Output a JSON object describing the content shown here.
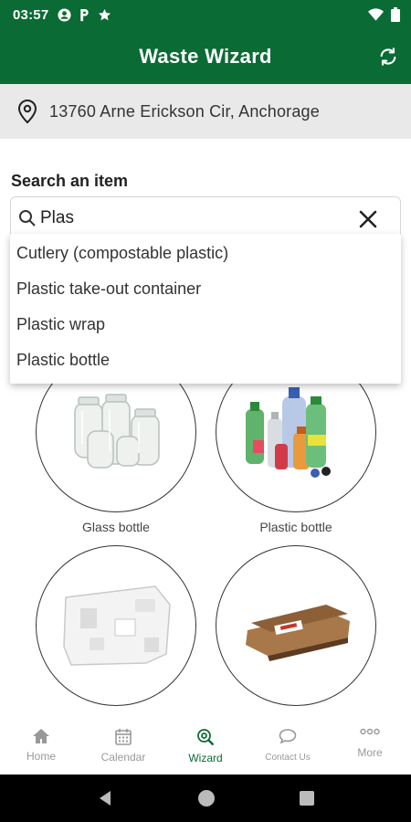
{
  "status_bar": {
    "time": "03:57",
    "icons": [
      "account-circle-icon",
      "p-icon",
      "star-icon"
    ],
    "right_icons": [
      "wifi-icon",
      "battery-icon"
    ]
  },
  "app_bar": {
    "title": "Waste Wizard",
    "refresh_icon": "refresh-icon"
  },
  "address": {
    "text": "13760 Arne Erickson Cir, Anchorage",
    "icon": "location-pin-icon"
  },
  "search": {
    "label": "Search an item",
    "value": "Plas",
    "suggestions": [
      "Cutlery (compostable plastic)",
      "Plastic take-out container",
      "Plastic wrap",
      "Plastic bottle"
    ]
  },
  "items": [
    {
      "caption": "Glass bottle",
      "image": "glass-jars"
    },
    {
      "caption": "Plastic bottle",
      "image": "plastic-bottles"
    },
    {
      "caption": "",
      "image": "styrofoam-packaging"
    },
    {
      "caption": "",
      "image": "flattened-cardboard"
    }
  ],
  "bottom_nav": {
    "items": [
      {
        "label": "Home",
        "icon": "home-icon",
        "active": false
      },
      {
        "label": "Calendar",
        "icon": "calendar-icon",
        "active": false
      },
      {
        "label": "Wizard",
        "icon": "wizard-search-icon",
        "active": true
      },
      {
        "label": "Contact Us",
        "icon": "chat-icon",
        "active": false
      },
      {
        "label": "More",
        "icon": "more-icon",
        "active": false
      }
    ]
  },
  "colors": {
    "brand": "#0b6b35",
    "address_bg": "#e9e9e9",
    "inactive": "#999999"
  }
}
